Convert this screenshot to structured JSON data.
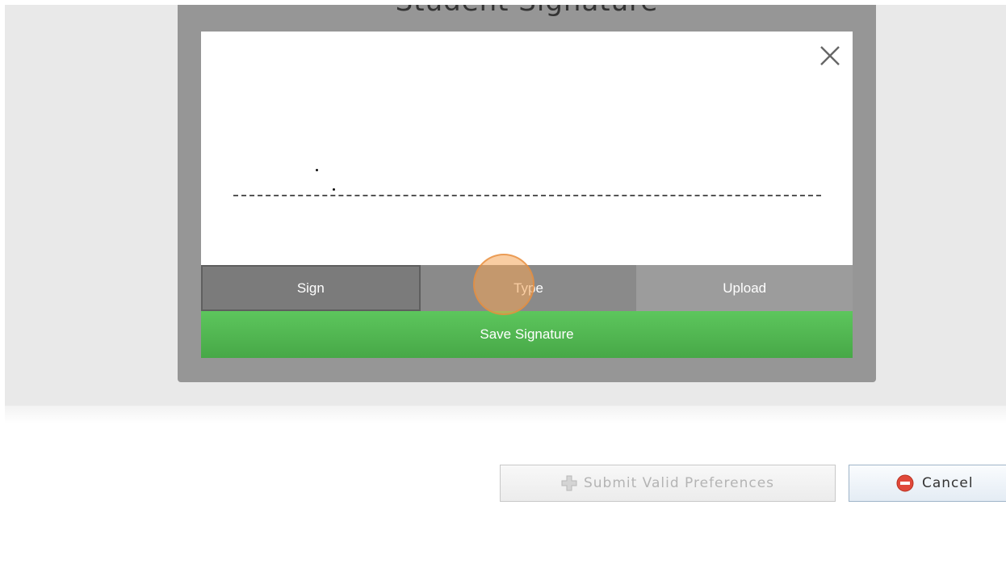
{
  "modal": {
    "title": "Student Signature",
    "tabs": [
      {
        "label": "Sign",
        "active": true
      },
      {
        "label": "Type",
        "active": false
      },
      {
        "label": "Upload",
        "active": false
      }
    ],
    "save_label": "Save Signature",
    "close_icon": "close-icon"
  },
  "actions": {
    "submit_label": "Submit Valid Preferences",
    "submit_icon": "plus-icon",
    "submit_enabled": false,
    "cancel_label": "Cancel",
    "cancel_icon": "stop-icon"
  },
  "colors": {
    "modal_frame": "#969696",
    "save_button": "#52b852",
    "click_highlight": "#f4a456",
    "cancel_icon": "#e0483a"
  }
}
